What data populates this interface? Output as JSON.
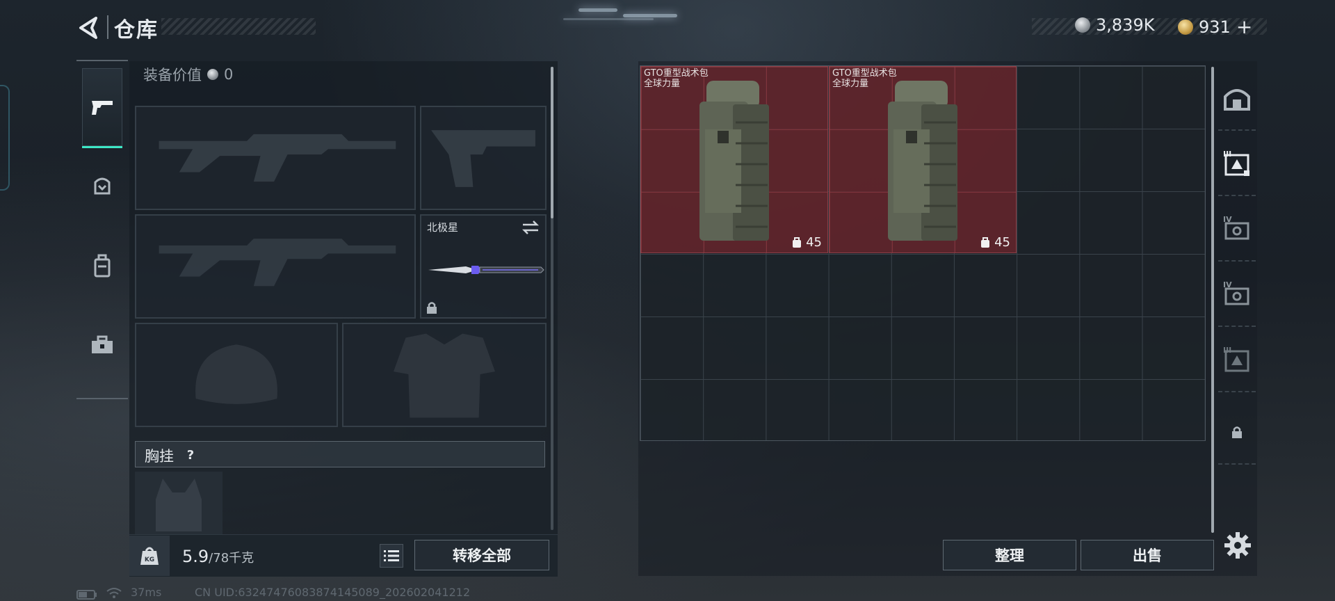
{
  "header": {
    "title": "仓库",
    "back_icon": "back-arrow-icon"
  },
  "currency": [
    {
      "icon": "silver-coin-icon",
      "value": "3,839K"
    },
    {
      "icon": "gold-coin-icon",
      "value": "931",
      "add_symbol": "+"
    }
  ],
  "left_tabs": [
    {
      "icon": "pistol-icon",
      "active": true
    },
    {
      "icon": "helmet-vest-icon",
      "active": false
    },
    {
      "icon": "backpack-icon",
      "active": false
    },
    {
      "icon": "toolbox-icon",
      "active": false
    }
  ],
  "loadout": {
    "equip_value_label": "装备价值",
    "equip_value": "0",
    "knife": {
      "name": "北极星",
      "swap_icon": "swap-icon",
      "lock_icon": "lock-icon"
    },
    "chest_label": "胸挂",
    "help_symbol": "?"
  },
  "weight": {
    "current": "5.9",
    "max": "/78千克",
    "icon": "weight-kg-icon"
  },
  "buttons": {
    "transfer_all": "转移全部",
    "sort": "整理",
    "sell": "出售"
  },
  "storage": {
    "items": [
      {
        "name_line1": "GTO重型战术包",
        "name_line2": "全球力量",
        "value": "45",
        "rarity_color": "#7a2a31"
      },
      {
        "name_line1": "GTO重型战术包",
        "name_line2": "全球力量",
        "value": "45",
        "rarity_color": "#7a2a31"
      }
    ]
  },
  "right_tabs": [
    {
      "icon": "vault-icon"
    },
    {
      "label": "III",
      "icon": "container-tier-3-icon",
      "active": true
    },
    {
      "label": "IV",
      "icon": "container-tier-4-icon"
    },
    {
      "label": "IV",
      "icon": "container-tier-4-icon"
    },
    {
      "label": "III",
      "icon": "container-tier-3-icon"
    },
    {
      "icon": "lock-icon"
    }
  ],
  "status_bar": {
    "ping": "37ms",
    "uid": "CN UID:632474760838741450​89_202602041212"
  }
}
